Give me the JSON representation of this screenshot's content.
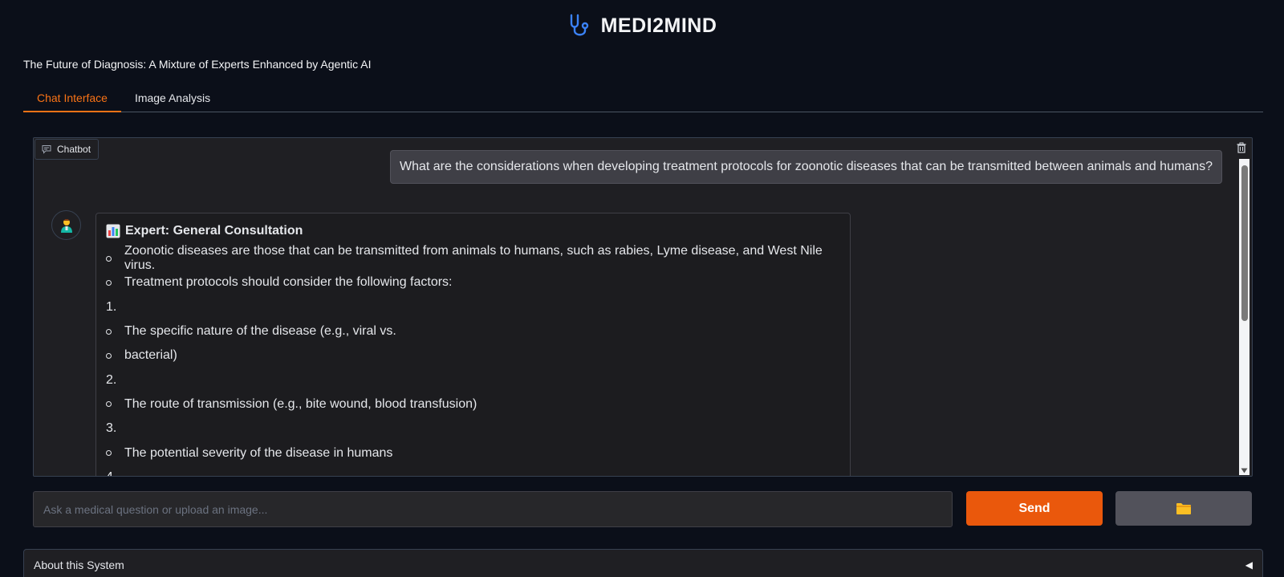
{
  "header": {
    "title": "MEDI2MIND",
    "subtitle": "The Future of Diagnosis: A Mixture of Experts Enhanced by Agentic AI",
    "logo_icon": "stethoscope-icon",
    "accent_color": "#3b82f6"
  },
  "tabs": [
    {
      "label": "Chat Interface",
      "active": true
    },
    {
      "label": "Image Analysis",
      "active": false
    }
  ],
  "chatbot": {
    "label": "Chatbot",
    "user_message": "What are the considerations when developing treatment protocols for zoonotic diseases that can be transmitted between animals and humans?",
    "bot_message": {
      "heading": "Expert: General Consultation",
      "lines": [
        {
          "marker": "bullet",
          "text": "Zoonotic diseases are those that can be transmitted from animals to humans, such as rabies, Lyme disease, and West Nile virus."
        },
        {
          "marker": "bullet",
          "text": "Treatment protocols should consider the following factors:"
        },
        {
          "marker": "1.",
          "text": ""
        },
        {
          "marker": "bullet",
          "text": "The specific nature of the disease (e.g., viral vs."
        },
        {
          "marker": "bullet",
          "text": "bacterial)"
        },
        {
          "marker": "2.",
          "text": ""
        },
        {
          "marker": "bullet",
          "text": "The route of transmission (e.g., bite wound, blood transfusion)"
        },
        {
          "marker": "3.",
          "text": ""
        },
        {
          "marker": "bullet",
          "text": "The potential severity of the disease in humans"
        },
        {
          "marker": "4.",
          "text": ""
        }
      ]
    }
  },
  "input": {
    "placeholder": "Ask a medical question or upload an image...",
    "value": ""
  },
  "buttons": {
    "send_label": "Send",
    "upload_icon": "folder-icon",
    "send_color": "#ea580c"
  },
  "accordion": {
    "label": "About this System",
    "arrow": "◀"
  }
}
